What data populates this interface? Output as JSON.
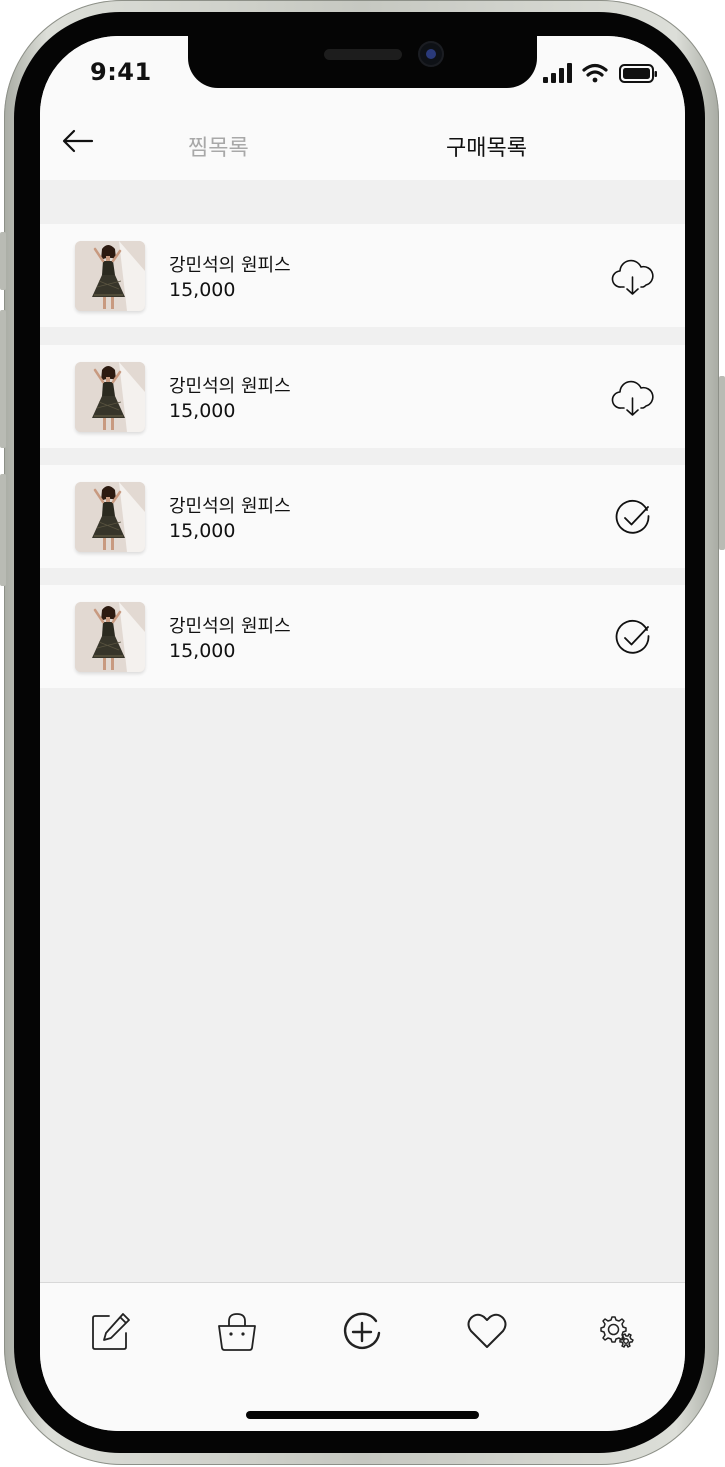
{
  "status_bar": {
    "time": "9:41"
  },
  "header": {
    "tabs": [
      {
        "label": "찜목록",
        "active": false
      },
      {
        "label": "구매목록",
        "active": true
      }
    ]
  },
  "purchases": [
    {
      "name": "강민석의 원피스",
      "price": "15,000",
      "action_icon": "cloud-download-icon"
    },
    {
      "name": "강민석의 원피스",
      "price": "15,000",
      "action_icon": "cloud-download-icon"
    },
    {
      "name": "강민석의 원피스",
      "price": "15,000",
      "action_icon": "check-circle-icon"
    },
    {
      "name": "강민석의 원피스",
      "price": "15,000",
      "action_icon": "check-circle-icon"
    }
  ],
  "bottom_nav": [
    {
      "icon": "edit-icon"
    },
    {
      "icon": "shopping-basket-icon"
    },
    {
      "icon": "add-circle-icon"
    },
    {
      "icon": "heart-icon"
    },
    {
      "icon": "settings-gear-icon"
    }
  ],
  "colors": {
    "background": "#f0f0f0",
    "surface": "#fafafa",
    "text": "#111111",
    "inactive_tab": "#a8a8a8"
  }
}
